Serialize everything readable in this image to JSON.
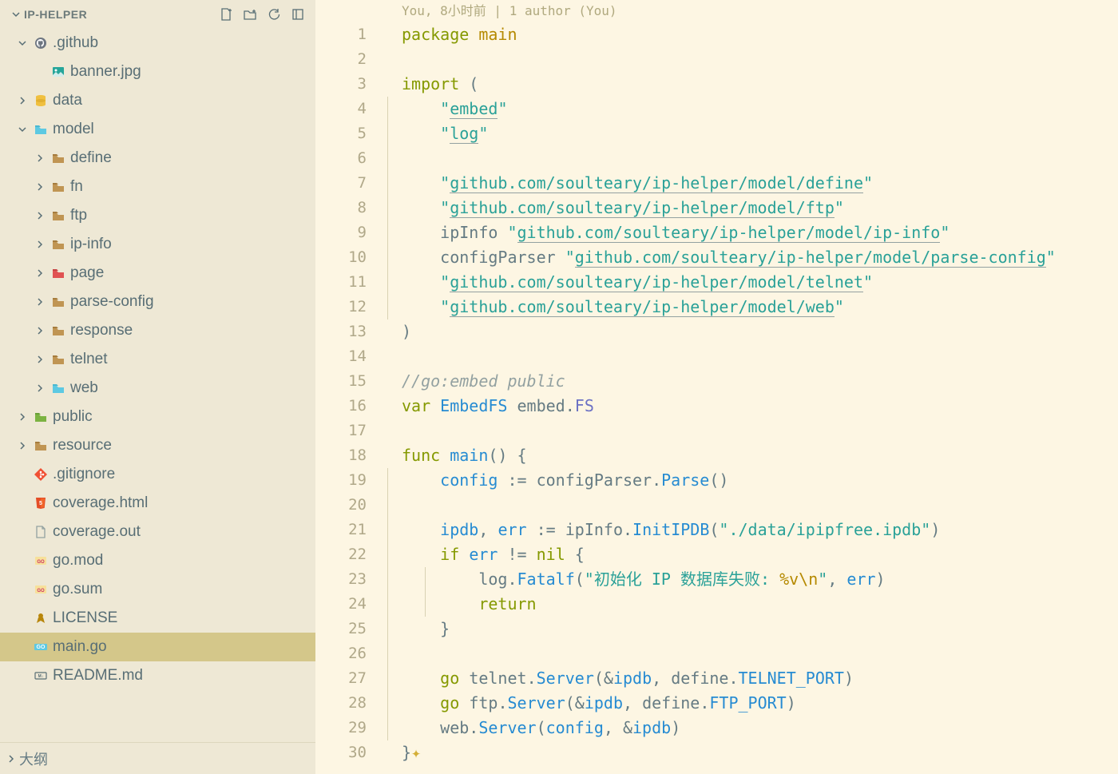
{
  "sidebar": {
    "title": "IP-HELPER",
    "outline": "大纲",
    "tree": [
      {
        "indent": 0,
        "chev": "down",
        "icon": "github",
        "label": ".github"
      },
      {
        "indent": 1,
        "chev": "",
        "icon": "image",
        "label": "banner.jpg"
      },
      {
        "indent": 0,
        "chev": "right",
        "icon": "db",
        "label": "data"
      },
      {
        "indent": 0,
        "chev": "down",
        "icon": "gopkg",
        "label": "model"
      },
      {
        "indent": 1,
        "chev": "right",
        "icon": "folder",
        "label": "define"
      },
      {
        "indent": 1,
        "chev": "right",
        "icon": "folder",
        "label": "fn"
      },
      {
        "indent": 1,
        "chev": "right",
        "icon": "folder",
        "label": "ftp"
      },
      {
        "indent": 1,
        "chev": "right",
        "icon": "folder",
        "label": "ip-info"
      },
      {
        "indent": 1,
        "chev": "right",
        "icon": "redfolder",
        "label": "page"
      },
      {
        "indent": 1,
        "chev": "right",
        "icon": "folder",
        "label": "parse-config"
      },
      {
        "indent": 1,
        "chev": "right",
        "icon": "folder",
        "label": "response"
      },
      {
        "indent": 1,
        "chev": "right",
        "icon": "folder",
        "label": "telnet"
      },
      {
        "indent": 1,
        "chev": "right",
        "icon": "gopkg",
        "label": "web"
      },
      {
        "indent": 0,
        "chev": "right",
        "icon": "greenfolder",
        "label": "public"
      },
      {
        "indent": 0,
        "chev": "right",
        "icon": "folder",
        "label": "resource"
      },
      {
        "indent": 0,
        "chev": "",
        "icon": "git",
        "label": ".gitignore"
      },
      {
        "indent": 0,
        "chev": "",
        "icon": "html",
        "label": "coverage.html"
      },
      {
        "indent": 0,
        "chev": "",
        "icon": "file",
        "label": "coverage.out"
      },
      {
        "indent": 0,
        "chev": "",
        "icon": "gomod",
        "label": "go.mod"
      },
      {
        "indent": 0,
        "chev": "",
        "icon": "gomod",
        "label": "go.sum"
      },
      {
        "indent": 0,
        "chev": "",
        "icon": "license",
        "label": "LICENSE"
      },
      {
        "indent": 0,
        "chev": "",
        "icon": "go",
        "label": "main.go",
        "selected": true
      },
      {
        "indent": 0,
        "chev": "",
        "icon": "md",
        "label": "README.md"
      }
    ]
  },
  "blame": "You, 8小时前 | 1 author (You)",
  "code": [
    {
      "n": 1,
      "t": [
        [
          "kw",
          "package "
        ],
        [
          "err",
          "main"
        ]
      ]
    },
    {
      "n": 2,
      "t": []
    },
    {
      "n": 3,
      "t": [
        [
          "kw",
          "import"
        ],
        [
          "op",
          " ("
        ]
      ]
    },
    {
      "n": 4,
      "g": 1,
      "t": [
        [
          "",
          "    "
        ],
        [
          "str",
          "\""
        ],
        [
          "str ul",
          "embed"
        ],
        [
          "str",
          "\""
        ]
      ]
    },
    {
      "n": 5,
      "g": 1,
      "t": [
        [
          "",
          "    "
        ],
        [
          "str",
          "\""
        ],
        [
          "str ul",
          "log"
        ],
        [
          "str",
          "\""
        ]
      ]
    },
    {
      "n": 6,
      "g": 1,
      "t": []
    },
    {
      "n": 7,
      "g": 1,
      "t": [
        [
          "",
          "    "
        ],
        [
          "str",
          "\""
        ],
        [
          "str ul",
          "github.com/soulteary/ip-helper/model/define"
        ],
        [
          "str",
          "\""
        ]
      ]
    },
    {
      "n": 8,
      "g": 1,
      "t": [
        [
          "",
          "    "
        ],
        [
          "str",
          "\""
        ],
        [
          "str ul",
          "github.com/soulteary/ip-helper/model/ftp"
        ],
        [
          "str",
          "\""
        ]
      ]
    },
    {
      "n": 9,
      "g": 1,
      "t": [
        [
          "",
          "    "
        ],
        [
          "alias",
          "ipInfo "
        ],
        [
          "str",
          "\""
        ],
        [
          "str ul",
          "github.com/soulteary/ip-helper/model/ip-info"
        ],
        [
          "str",
          "\""
        ]
      ]
    },
    {
      "n": 10,
      "g": 1,
      "t": [
        [
          "",
          "    "
        ],
        [
          "alias",
          "configParser "
        ],
        [
          "str",
          "\""
        ],
        [
          "str ul",
          "github.com/soulteary/ip-helper/model/parse-config"
        ],
        [
          "str",
          "\""
        ]
      ]
    },
    {
      "n": 11,
      "g": 1,
      "t": [
        [
          "",
          "    "
        ],
        [
          "str",
          "\""
        ],
        [
          "str ul",
          "github.com/soulteary/ip-helper/model/telnet"
        ],
        [
          "str",
          "\""
        ]
      ]
    },
    {
      "n": 12,
      "g": 1,
      "t": [
        [
          "",
          "    "
        ],
        [
          "str",
          "\""
        ],
        [
          "str ul",
          "github.com/soulteary/ip-helper/model/web"
        ],
        [
          "str",
          "\""
        ]
      ]
    },
    {
      "n": 13,
      "t": [
        [
          "op",
          ")"
        ]
      ]
    },
    {
      "n": 14,
      "t": []
    },
    {
      "n": 15,
      "t": [
        [
          "cm",
          "//go:embed public"
        ]
      ]
    },
    {
      "n": 16,
      "t": [
        [
          "kw",
          "var"
        ],
        [
          "",
          " "
        ],
        [
          "id",
          "EmbedFS"
        ],
        [
          "",
          " "
        ],
        [
          "alias",
          "embed"
        ],
        [
          "op",
          "."
        ],
        [
          "typ",
          "FS"
        ]
      ]
    },
    {
      "n": 17,
      "t": []
    },
    {
      "n": 18,
      "t": [
        [
          "kw",
          "func"
        ],
        [
          "",
          " "
        ],
        [
          "fn",
          "main"
        ],
        [
          "op",
          "() {"
        ]
      ]
    },
    {
      "n": 19,
      "g": 1,
      "t": [
        [
          "",
          "    "
        ],
        [
          "id",
          "config"
        ],
        [
          "",
          " "
        ],
        [
          "op",
          ":= "
        ],
        [
          "alias",
          "configParser"
        ],
        [
          "op",
          "."
        ],
        [
          "fn",
          "Parse"
        ],
        [
          "op",
          "()"
        ]
      ]
    },
    {
      "n": 20,
      "g": 1,
      "t": []
    },
    {
      "n": 21,
      "g": 1,
      "t": [
        [
          "",
          "    "
        ],
        [
          "id",
          "ipdb"
        ],
        [
          "op",
          ", "
        ],
        [
          "id",
          "err"
        ],
        [
          "",
          " "
        ],
        [
          "op",
          ":= "
        ],
        [
          "alias",
          "ipInfo"
        ],
        [
          "op",
          "."
        ],
        [
          "fn",
          "InitIPDB"
        ],
        [
          "op",
          "("
        ],
        [
          "str",
          "\"./data/ipipfree.ipdb\""
        ],
        [
          "op",
          ")"
        ]
      ]
    },
    {
      "n": 22,
      "g": 1,
      "t": [
        [
          "",
          "    "
        ],
        [
          "kw",
          "if"
        ],
        [
          "",
          " "
        ],
        [
          "id",
          "err"
        ],
        [
          "",
          " "
        ],
        [
          "op",
          "!= "
        ],
        [
          "kw",
          "nil"
        ],
        [
          "op",
          " {"
        ]
      ]
    },
    {
      "n": 23,
      "g": 2,
      "t": [
        [
          "",
          "        "
        ],
        [
          "alias",
          "log"
        ],
        [
          "op",
          "."
        ],
        [
          "fn",
          "Fatalf"
        ],
        [
          "op",
          "("
        ],
        [
          "str",
          "\"初始化 IP 数据库失败: "
        ],
        [
          "err",
          "%v\\n"
        ],
        [
          "str",
          "\""
        ],
        [
          "op",
          ", "
        ],
        [
          "id",
          "err"
        ],
        [
          "op",
          ")"
        ]
      ]
    },
    {
      "n": 24,
      "g": 2,
      "t": [
        [
          "",
          "        "
        ],
        [
          "kw",
          "return"
        ]
      ]
    },
    {
      "n": 25,
      "g": 1,
      "t": [
        [
          "",
          "    "
        ],
        [
          "op",
          "}"
        ]
      ]
    },
    {
      "n": 26,
      "g": 1,
      "t": []
    },
    {
      "n": 27,
      "g": 1,
      "t": [
        [
          "",
          "    "
        ],
        [
          "kw",
          "go"
        ],
        [
          "",
          " "
        ],
        [
          "alias",
          "telnet"
        ],
        [
          "op",
          "."
        ],
        [
          "fn",
          "Server"
        ],
        [
          "op",
          "(&"
        ],
        [
          "id",
          "ipdb"
        ],
        [
          "op",
          ", "
        ],
        [
          "alias",
          "define"
        ],
        [
          "op",
          "."
        ],
        [
          "id",
          "TELNET_PORT"
        ],
        [
          "op",
          ")"
        ]
      ]
    },
    {
      "n": 28,
      "g": 1,
      "t": [
        [
          "",
          "    "
        ],
        [
          "kw",
          "go"
        ],
        [
          "",
          " "
        ],
        [
          "alias",
          "ftp"
        ],
        [
          "op",
          "."
        ],
        [
          "fn",
          "Server"
        ],
        [
          "op",
          "(&"
        ],
        [
          "id",
          "ipdb"
        ],
        [
          "op",
          ", "
        ],
        [
          "alias",
          "define"
        ],
        [
          "op",
          "."
        ],
        [
          "id",
          "FTP_PORT"
        ],
        [
          "op",
          ")"
        ]
      ]
    },
    {
      "n": 29,
      "g": 1,
      "t": [
        [
          "",
          "    "
        ],
        [
          "alias",
          "web"
        ],
        [
          "op",
          "."
        ],
        [
          "fn",
          "Server"
        ],
        [
          "op",
          "("
        ],
        [
          "id",
          "config"
        ],
        [
          "op",
          ", &"
        ],
        [
          "id",
          "ipdb"
        ],
        [
          "op",
          ")"
        ]
      ]
    },
    {
      "n": 30,
      "t": [
        [
          "op",
          "}"
        ],
        [
          "sparkle",
          "✦"
        ]
      ]
    }
  ]
}
